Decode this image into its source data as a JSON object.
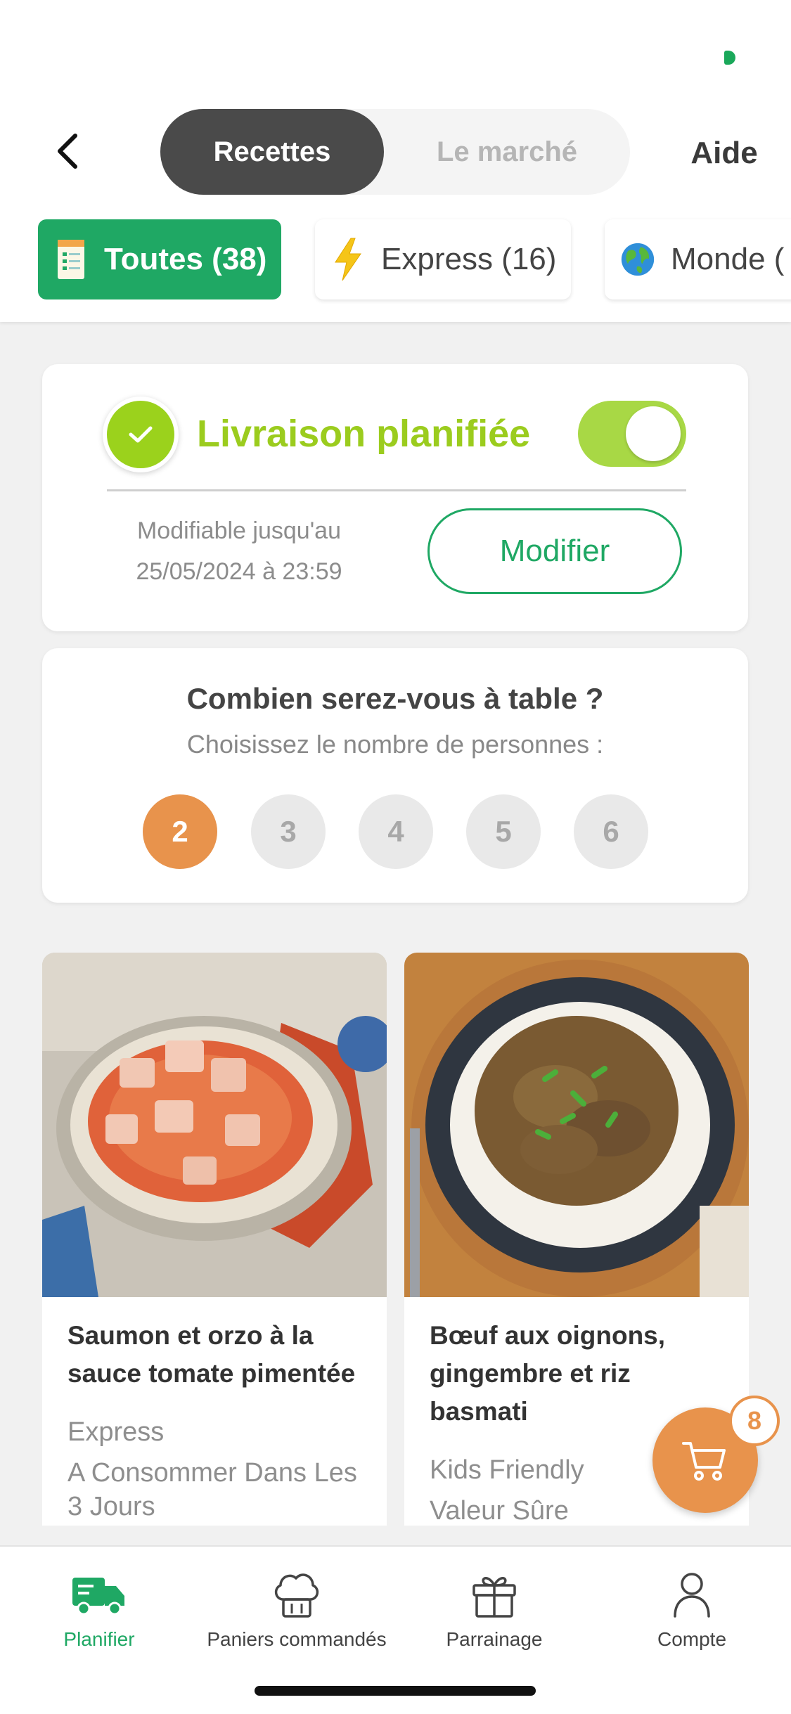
{
  "header": {
    "tabs": [
      {
        "label": "Recettes",
        "active": true
      },
      {
        "label": "Le marché",
        "active": false
      }
    ],
    "help_label": "Aide"
  },
  "filters": [
    {
      "label": "Toutes (38)",
      "icon": "recipe-list-icon",
      "active": true
    },
    {
      "label": "Express (16)",
      "icon": "lightning-icon",
      "active": false
    },
    {
      "label": "Monde (",
      "icon": "globe-icon",
      "active": false
    }
  ],
  "delivery": {
    "title": "Livraison planifiée",
    "toggle_on": true,
    "modifiable_line1": "Modifiable jusqu'au",
    "modifiable_line2": "25/05/2024 à 23:59",
    "modify_button": "Modifier"
  },
  "people": {
    "title": "Combien serez-vous à table ?",
    "subtitle": "Choisissez le nombre de personnes :",
    "options": [
      "2",
      "3",
      "4",
      "5",
      "6"
    ],
    "selected": "2"
  },
  "recipes": [
    {
      "title": "Saumon et orzo à la sauce tomate pimentée",
      "tags": [
        "Express",
        "A Consommer Dans Les 3 Jours"
      ]
    },
    {
      "title": "Bœuf aux oignons, gingembre et riz basmati",
      "tags": [
        "Kids Friendly",
        "Valeur Sûre"
      ]
    }
  ],
  "cart": {
    "count": "8"
  },
  "bottom_nav": [
    {
      "label": "Planifier",
      "icon": "truck-icon",
      "active": true
    },
    {
      "label": "Paniers commandés",
      "icon": "chef-hat-icon",
      "active": false
    },
    {
      "label": "Parrainage",
      "icon": "gift-icon",
      "active": false
    },
    {
      "label": "Compte",
      "icon": "person-icon",
      "active": false
    }
  ],
  "colors": {
    "green": "#1fa864",
    "lime": "#9bcc1e",
    "orange": "#e8934c",
    "dark_tab": "#4a4a4a"
  }
}
